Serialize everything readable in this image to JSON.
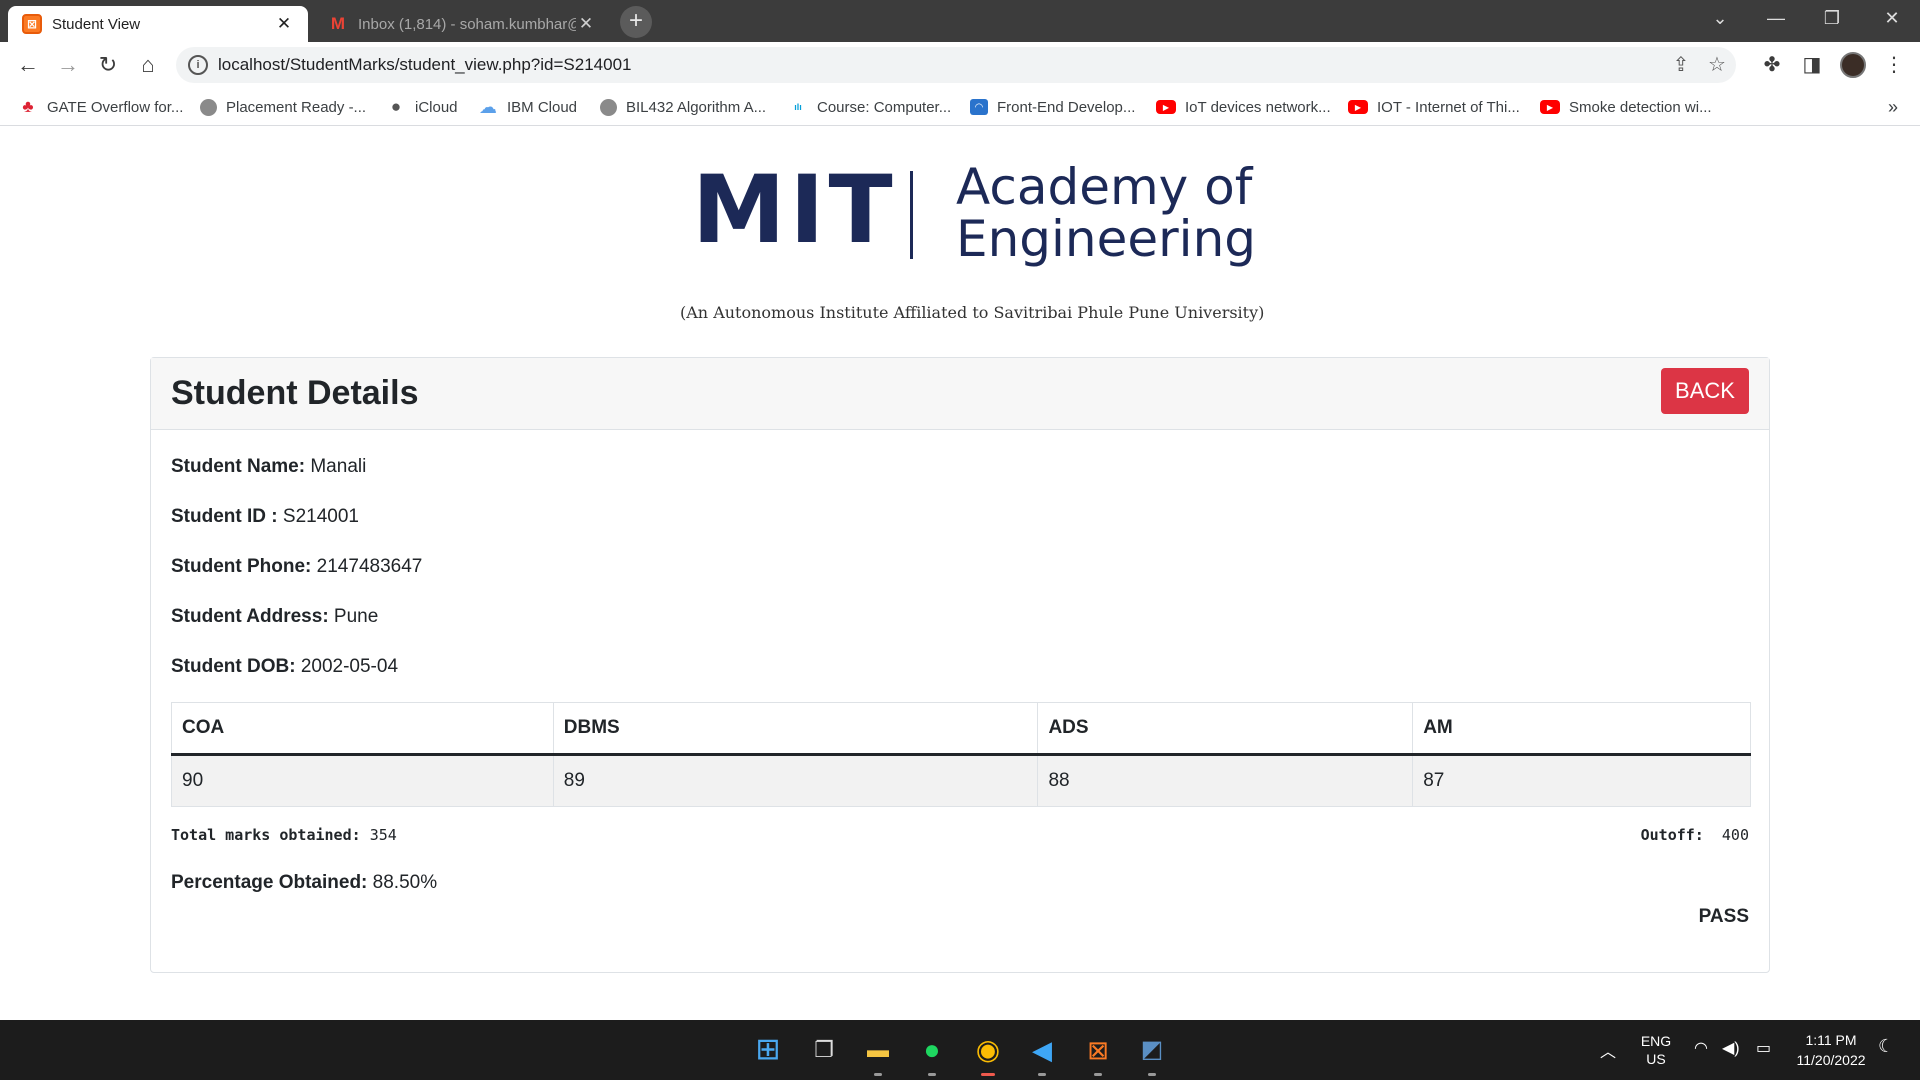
{
  "browser": {
    "tabs": [
      {
        "title": "Student View",
        "favicon": "xampp-icon",
        "active": true
      },
      {
        "title": "Inbox (1,814) - soham.kumbhar@",
        "favicon": "gmail-icon",
        "active": false
      }
    ],
    "url": "localhost/StudentMarks/student_view.php?id=S214001",
    "bookmarks": [
      {
        "label": "GATE Overflow for...",
        "icon": "gate-icon"
      },
      {
        "label": "Placement Ready -...",
        "icon": "globe-icon"
      },
      {
        "label": "iCloud",
        "icon": "apple-icon"
      },
      {
        "label": "IBM Cloud",
        "icon": "cloud-icon"
      },
      {
        "label": "BIL432 Algorithm A...",
        "icon": "globe-icon"
      },
      {
        "label": "Course: Computer...",
        "icon": "cisco-icon"
      },
      {
        "label": "Front-End Develop...",
        "icon": "coursera-icon"
      },
      {
        "label": "IoT devices network...",
        "icon": "youtube-icon"
      },
      {
        "label": "IOT - Internet of Thi...",
        "icon": "youtube-icon"
      },
      {
        "label": "Smoke detection wi...",
        "icon": "youtube-icon"
      }
    ],
    "bookmarks_more": "»"
  },
  "header": {
    "logo_mit": "MIT",
    "logo_line1": "Academy of",
    "logo_line2": "Engineering",
    "logo_subtitle": "(An Autonomous Institute Affiliated to Savitribai Phule Pune University)"
  },
  "card": {
    "title": "Student Details",
    "back_label": "BACK",
    "fields": [
      {
        "label": "Student Name:",
        "value": "Manali"
      },
      {
        "label": "Student ID :",
        "value": "S214001"
      },
      {
        "label": "Student Phone:",
        "value": "2147483647"
      },
      {
        "label": "Student Address:",
        "value": "Pune"
      },
      {
        "label": "Student DOB:",
        "value": "2002-05-04"
      }
    ],
    "marks_table": {
      "headers": [
        "COA",
        "DBMS",
        "ADS",
        "AM"
      ],
      "values": [
        "90",
        "89",
        "88",
        "87"
      ]
    },
    "total_label": "Total marks obtained:",
    "total_value": "354",
    "outoff_label": "Outoff:",
    "outoff_value": "400",
    "percentage_label": "Percentage Obtained:",
    "percentage_value": "88.50%",
    "result": "PASS"
  },
  "taskbar": {
    "lang_line1": "ENG",
    "lang_line2": "US",
    "time": "1:11 PM",
    "date": "11/20/2022"
  },
  "colors": {
    "back_button": "#dc3545",
    "logo_navy": "#1c2957",
    "tab_strip": "#3c3c3c"
  }
}
